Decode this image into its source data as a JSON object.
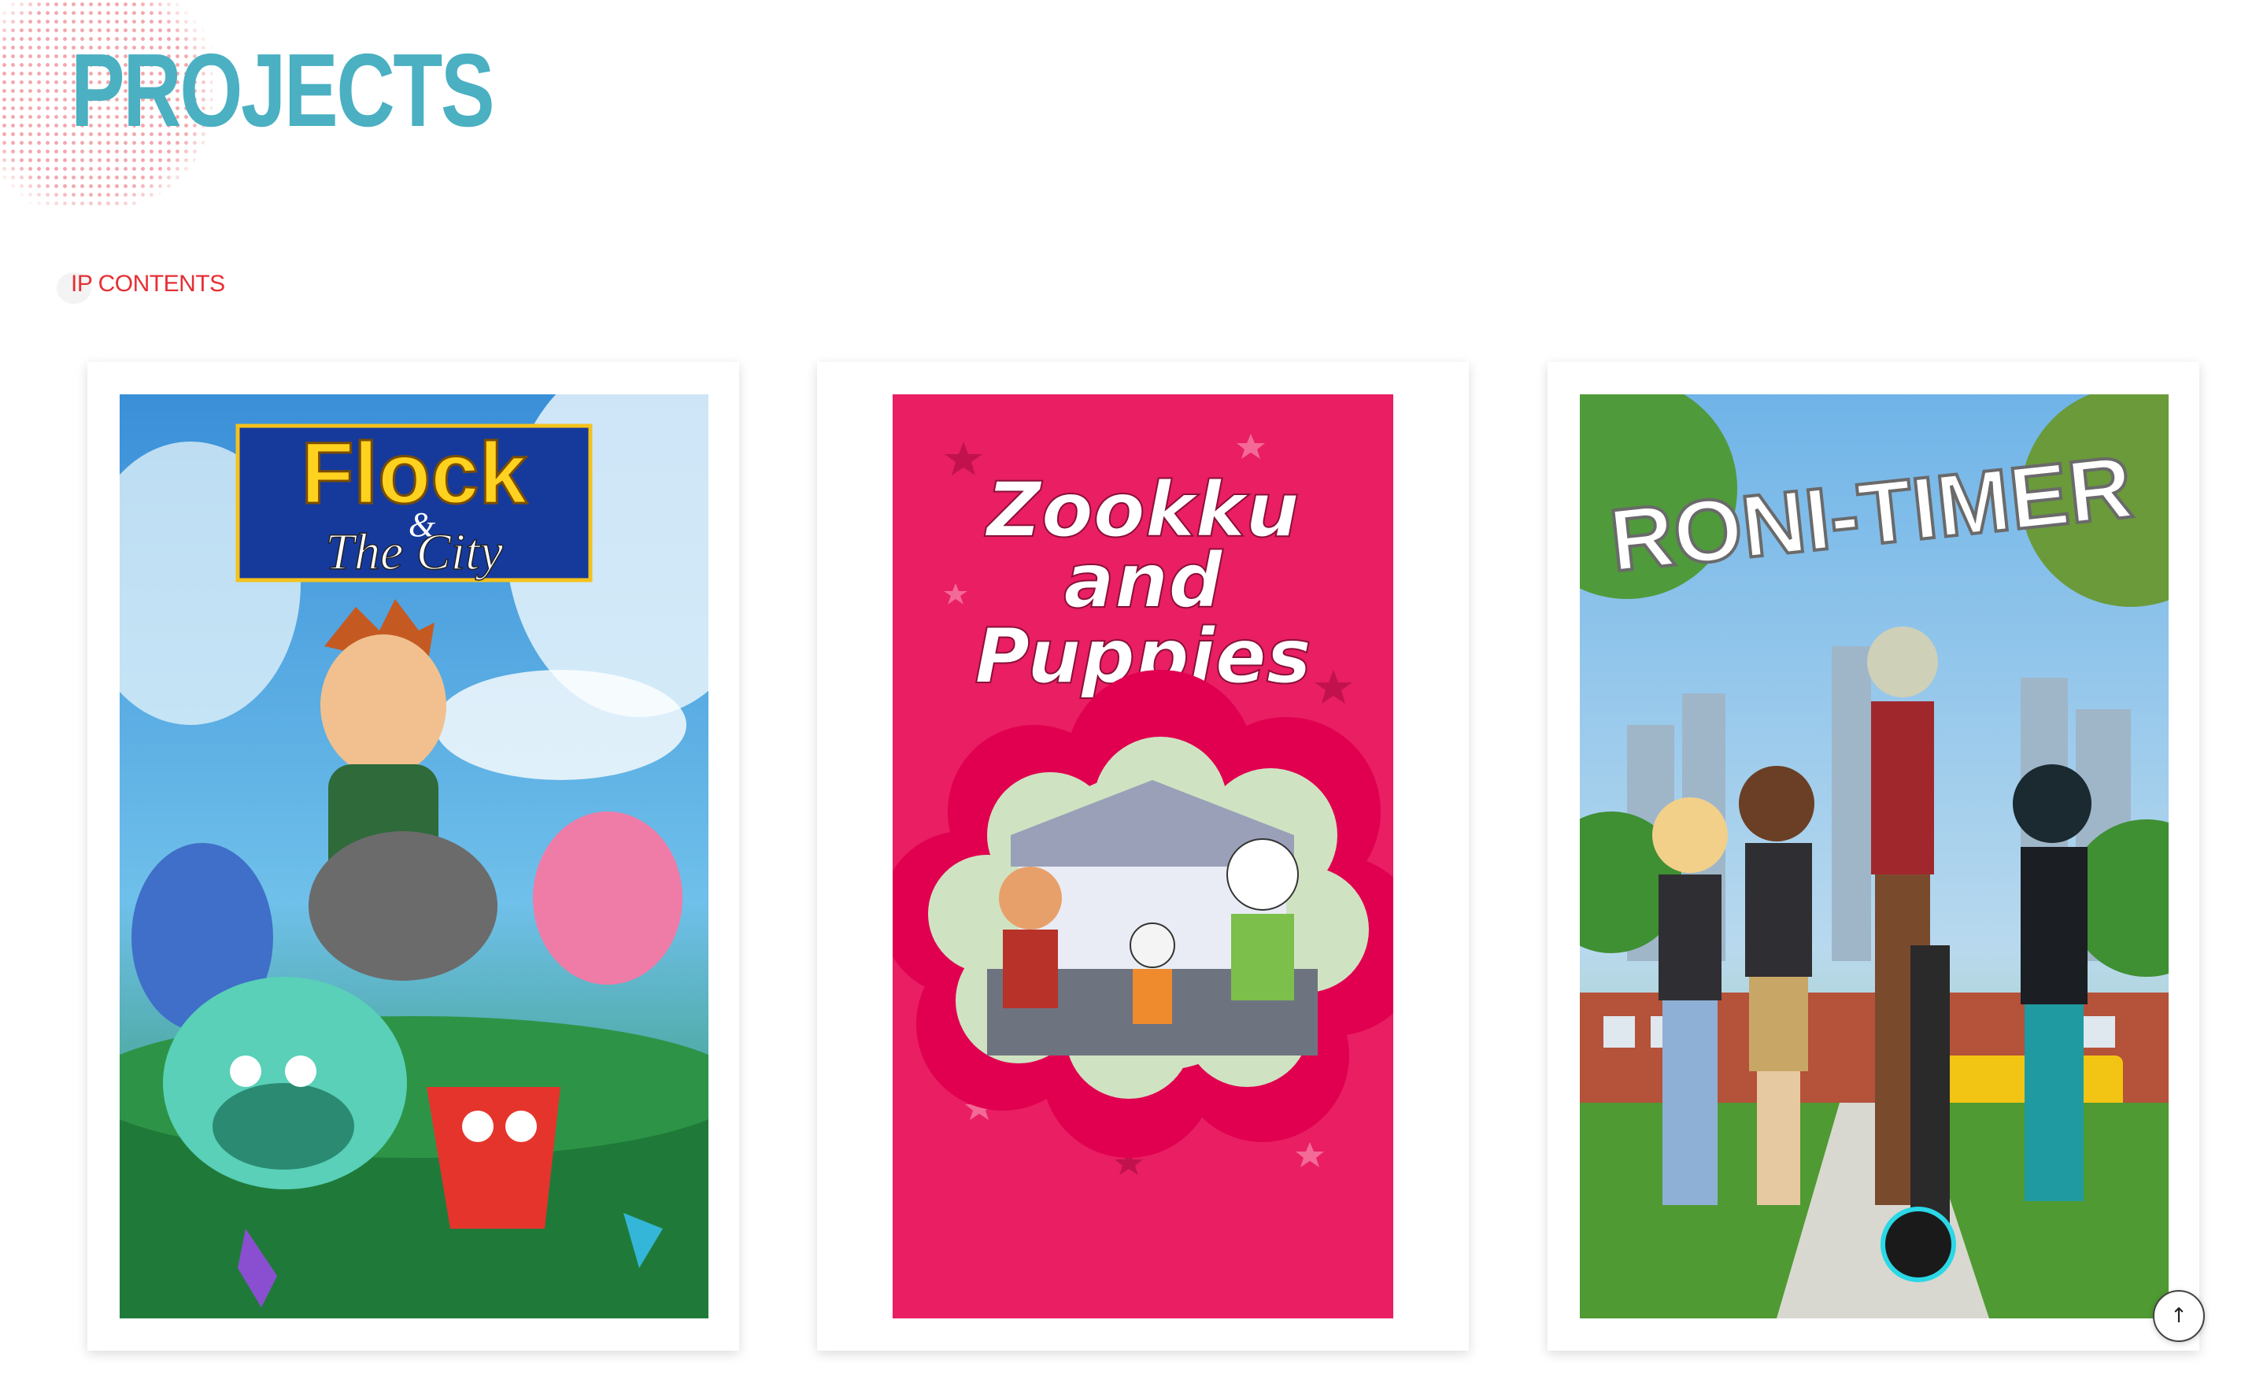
{
  "header": {
    "title": "PROJECTS"
  },
  "section": {
    "label": "IP CONTENTS"
  },
  "colors": {
    "title": "#4ab0c2",
    "label": "#e62f34",
    "dots": "#f3a7ad",
    "pink_poster": "#e91e63"
  },
  "projects": [
    {
      "poster_text_1": "Flock",
      "poster_text_2": "The City",
      "amp": "&"
    },
    {
      "poster_line_1": "Zookku",
      "poster_line_2": "and",
      "poster_line_3": "Puppies"
    },
    {
      "poster_text": "RONI-TIMER"
    }
  ],
  "scroll_top": {
    "icon": "↑",
    "icon_name": "arrow-up-icon"
  }
}
